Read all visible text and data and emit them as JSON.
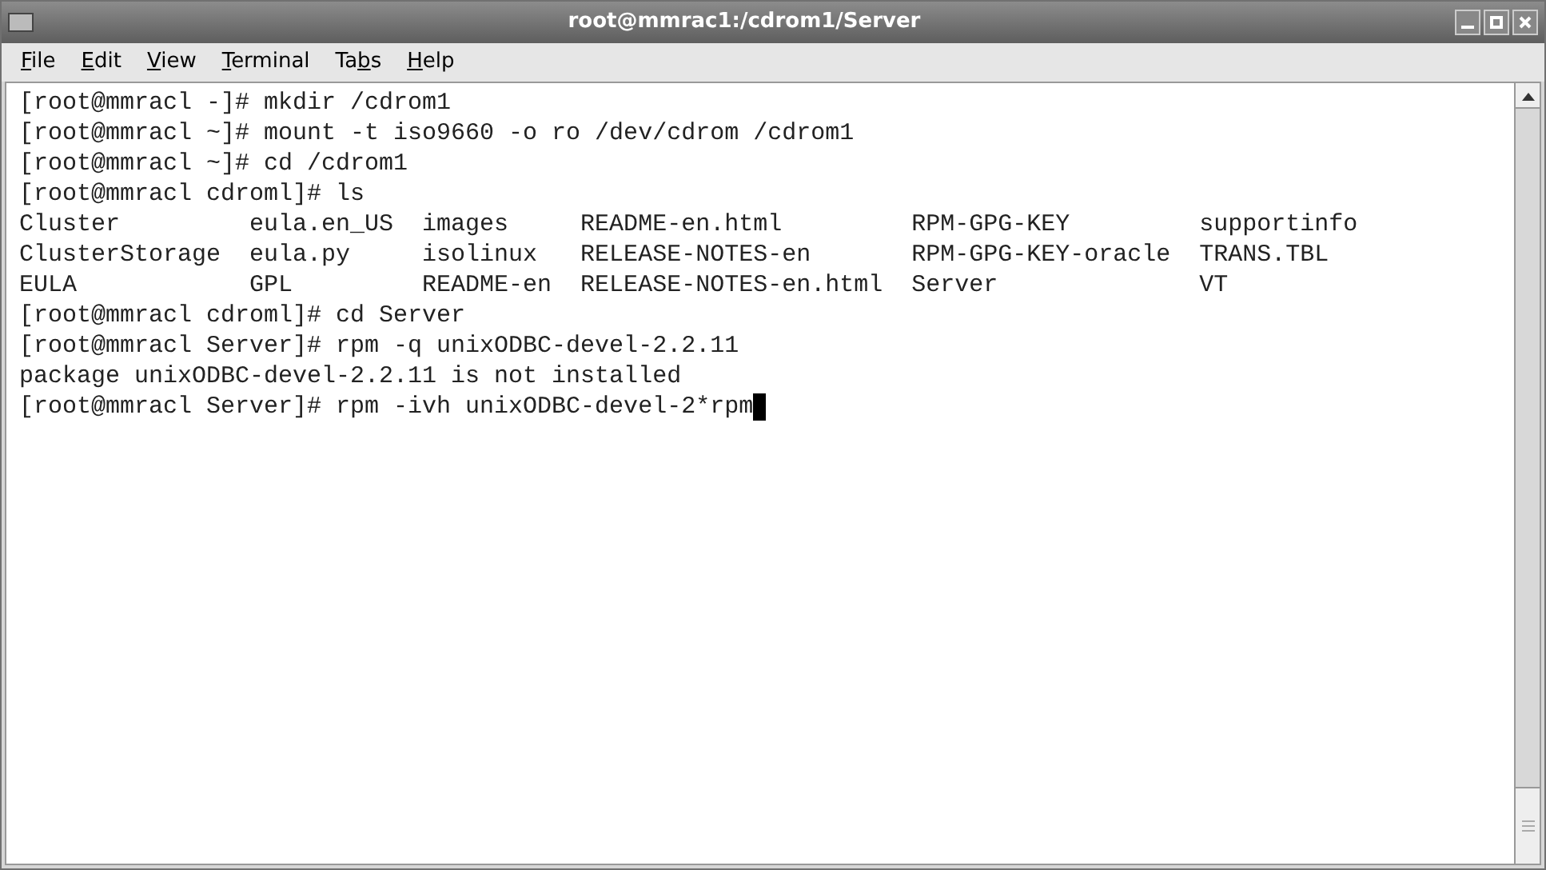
{
  "window": {
    "title": "root@mmrac1:/cdrom1/Server"
  },
  "menu": [
    {
      "key": "F",
      "after": "ile"
    },
    {
      "key": "E",
      "after": "dit"
    },
    {
      "key": "V",
      "after": "iew"
    },
    {
      "key": "T",
      "after": "erminal"
    },
    {
      "before": "Ta",
      "key": "b",
      "after": "s"
    },
    {
      "key": "H",
      "after": "elp"
    }
  ],
  "terminal": {
    "lines": [
      {
        "text": "[root@mmracl -]# mkdir /cdrom1",
        "cursor": false
      },
      {
        "text": "[root@mmracl ~]# mount -t iso9660 -o ro /dev/cdrom /cdrom1",
        "cursor": false
      },
      {
        "text": "[root@mmracl ~]# cd /cdrom1",
        "cursor": false
      },
      {
        "text": "[root@mmracl cdroml]# ls",
        "cursor": false
      },
      {
        "text": "Cluster         eula.en_US  images     README-en.html         RPM-GPG-KEY         supportinfo",
        "cursor": false
      },
      {
        "text": "ClusterStorage  eula.py     isolinux   RELEASE-NOTES-en       RPM-GPG-KEY-oracle  TRANS.TBL",
        "cursor": false
      },
      {
        "text": "EULA            GPL         README-en  RELEASE-NOTES-en.html  Server              VT",
        "cursor": false
      },
      {
        "text": "[root@mmracl cdroml]# cd Server",
        "cursor": false
      },
      {
        "text": "[root@mmracl Server]# rpm -q unixODBC-devel-2.2.11",
        "cursor": false
      },
      {
        "text": "package unixODBC-devel-2.2.11 is not installed",
        "cursor": false
      },
      {
        "text": "[root@mmracl Server]# rpm -ivh unixODBC-devel-2*rpm",
        "cursor": true
      }
    ]
  }
}
